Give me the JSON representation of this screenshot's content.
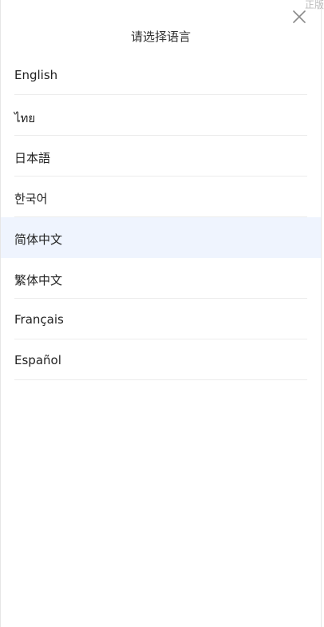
{
  "dialog": {
    "title": "请选择语言",
    "corner_text": "正版"
  },
  "languages": [
    {
      "label": "English",
      "selected": false
    },
    {
      "label": "ไทย",
      "selected": false
    },
    {
      "label": "日本語",
      "selected": false
    },
    {
      "label": "한국어",
      "selected": false
    },
    {
      "label": "简体中文",
      "selected": true
    },
    {
      "label": "繁体中文",
      "selected": false
    },
    {
      "label": "Français",
      "selected": false
    },
    {
      "label": "Español",
      "selected": false
    }
  ],
  "colors": {
    "selected_bg": "#eff4fe",
    "divider": "#ececec",
    "text": "#222222"
  },
  "icons": {
    "close": "close-icon"
  }
}
